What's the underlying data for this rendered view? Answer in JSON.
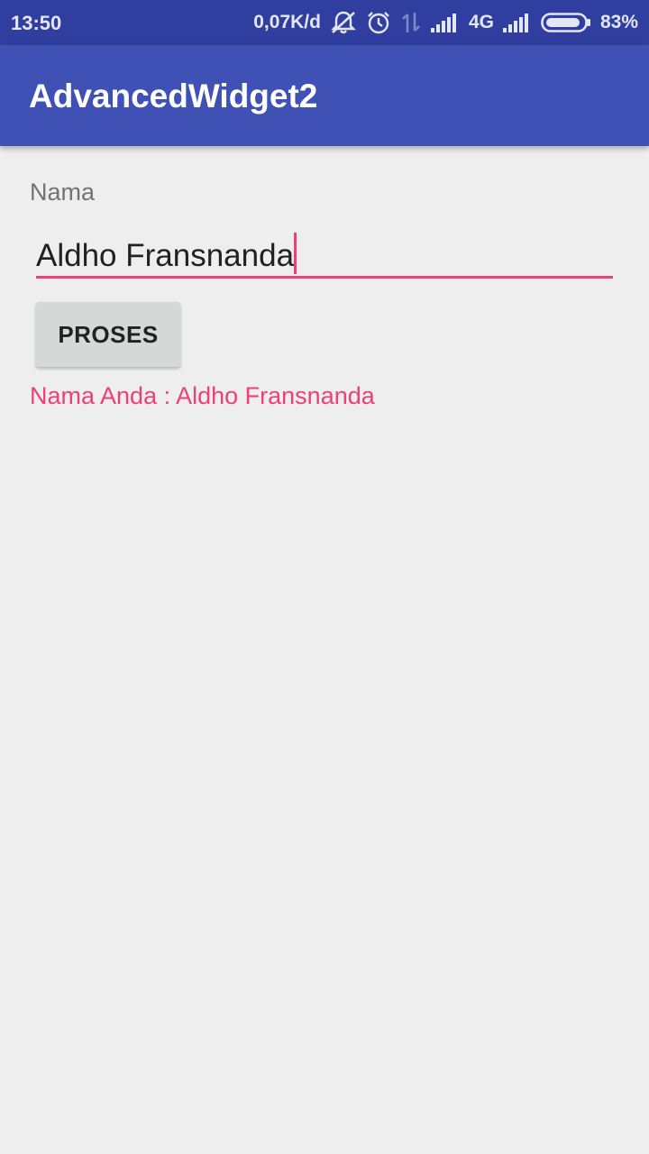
{
  "status_bar": {
    "time": "13:50",
    "net_speed": "0,07K/d",
    "network_type": "4G",
    "battery": "83%",
    "icons": [
      "mute-icon",
      "alarm-icon",
      "data-arrows-icon",
      "signal-icon",
      "signal-icon",
      "battery-icon"
    ]
  },
  "app_bar": {
    "title": "AdvancedWidget2"
  },
  "form": {
    "label": "Nama",
    "input_value": "Aldho Fransnanda",
    "button_label": "PROSES",
    "result": "Nama Anda : Aldho Fransnanda"
  },
  "colors": {
    "status_bar": "#303f9f",
    "app_bar": "#3f51b5",
    "accent": "#ec407a",
    "background": "#eeeeee"
  }
}
